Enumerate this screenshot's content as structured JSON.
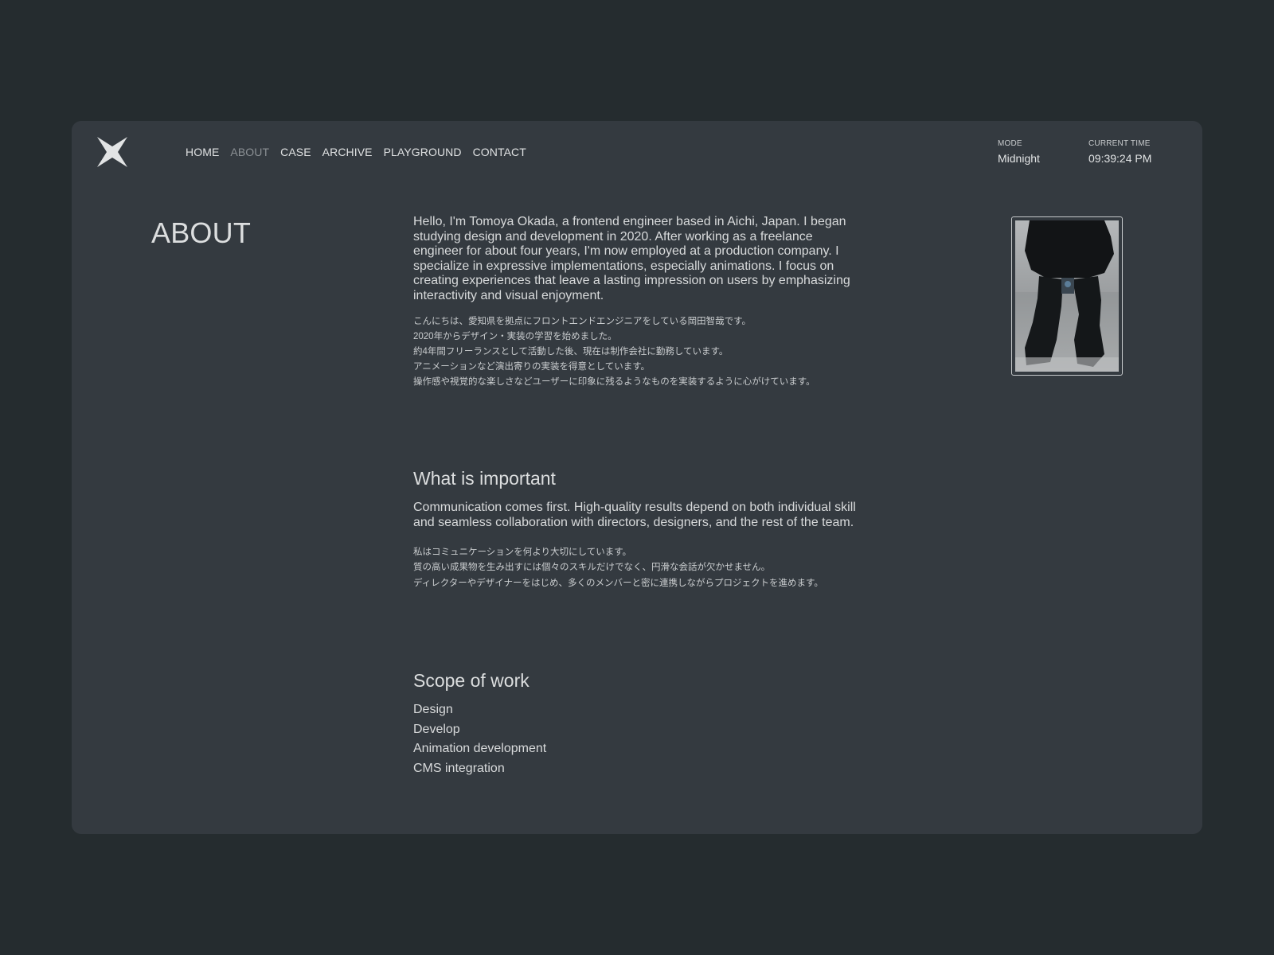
{
  "nav": {
    "items": [
      {
        "label": "HOME"
      },
      {
        "label": "ABOUT",
        "active": true
      },
      {
        "label": "CASE"
      },
      {
        "label": "ARCHIVE"
      },
      {
        "label": "PLAYGROUND"
      },
      {
        "label": "CONTACT"
      }
    ]
  },
  "status": {
    "mode_label": "MODE",
    "mode_value": "Midnight",
    "time_label": "CURRENT TIME",
    "time_value": "09:39:24 PM"
  },
  "page": {
    "title": "ABOUT"
  },
  "intro": {
    "en": "Hello, I'm Tomoya Okada, a frontend engineer based in Aichi, Japan. I began studying design and development in 2020. After working as a freelance engineer for about four years, I'm now employed at a production company. I specialize in expressive implementations, especially animations. I focus on creating experiences that leave a lasting impression on users by emphasizing interactivity and visual enjoyment.",
    "ja": [
      "こんにちは、愛知県を拠点にフロントエンドエンジニアをしている岡田智哉です。",
      "2020年からデザイン・実装の学習を始めました。",
      "約4年間フリーランスとして活動した後、現在は制作会社に勤務しています。",
      "アニメーションなど演出寄りの実装を得意としています。",
      "操作感や視覚的な楽しさなどユーザーに印象に残るようなものを実装するように心がけています。"
    ]
  },
  "important": {
    "heading": "What is important",
    "en": "Communication comes first. High-quality results depend on both individual skill and seamless collaboration with directors, designers, and the rest of the team.",
    "ja": [
      "私はコミュニケーションを何より大切にしています。",
      "質の高い成果物を生み出すには個々のスキルだけでなく、円滑な会話が欠かせません。",
      "ディレクターやデザイナーをはじめ、多くのメンバーと密に連携しながらプロジェクトを進めます。"
    ]
  },
  "scope": {
    "heading": "Scope of work",
    "items": [
      "Design",
      "Develop",
      "Animation development",
      "CMS integration"
    ]
  },
  "icons": {
    "logo": "four-point-star-icon",
    "portrait": "portrait-photo"
  },
  "colors": {
    "background": "#252c2f",
    "card": "#343a40",
    "text": "#d8dadb",
    "nav_active": "#8b9094"
  }
}
